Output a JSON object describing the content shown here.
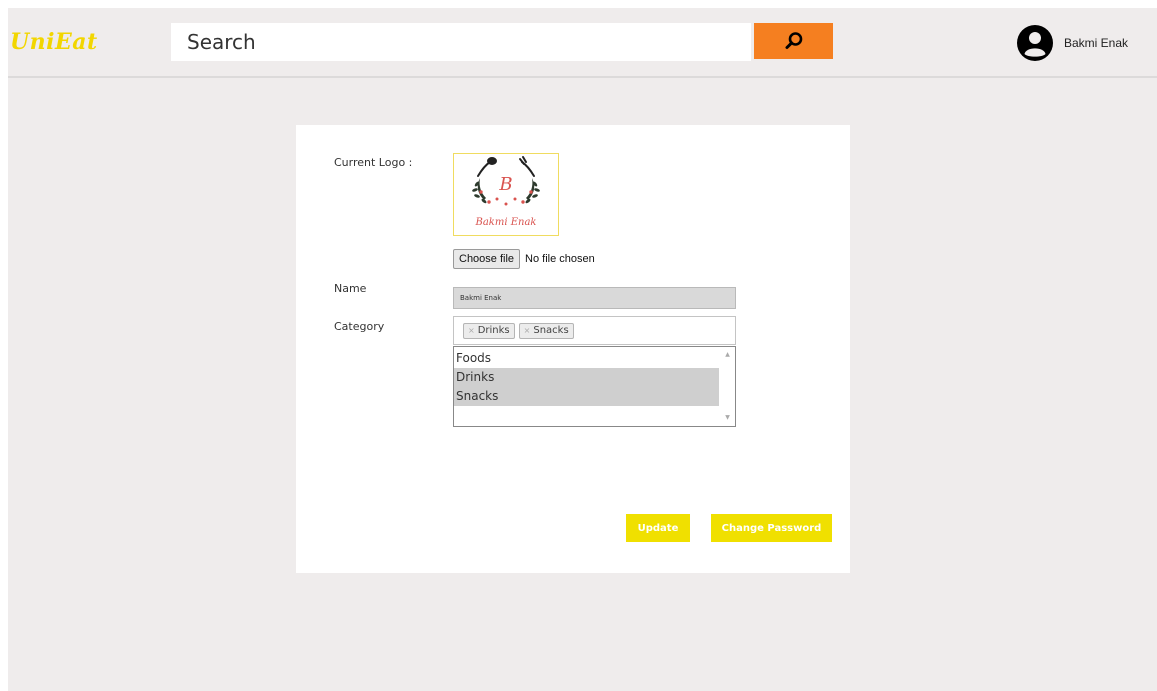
{
  "header": {
    "brand": "UniEat",
    "search_placeholder": "Search",
    "search_icon": "search-icon",
    "user_icon": "user-avatar-icon",
    "user_name": "Bakmi Enak"
  },
  "form": {
    "current_logo_label": "Current Logo :",
    "logo_image": {
      "initial": "B",
      "caption": "Bakmi Enak",
      "accent_color": "#d9534f"
    },
    "file_button_label": "Choose file",
    "file_status": "No file chosen",
    "name_label": "Name",
    "name_value": "Bakmi Enak",
    "category_label": "Category",
    "selected_tags": [
      "Drinks",
      "Snacks"
    ],
    "category_options": [
      {
        "label": "Foods",
        "selected": false
      },
      {
        "label": "Drinks",
        "selected": true
      },
      {
        "label": "Snacks",
        "selected": true
      }
    ],
    "update_label": "Update",
    "change_password_label": "Change Password"
  },
  "colors": {
    "brand": "#f2d600",
    "search_button": "#f57f20",
    "action_button": "#f0e000",
    "page_bg": "#efecec"
  }
}
